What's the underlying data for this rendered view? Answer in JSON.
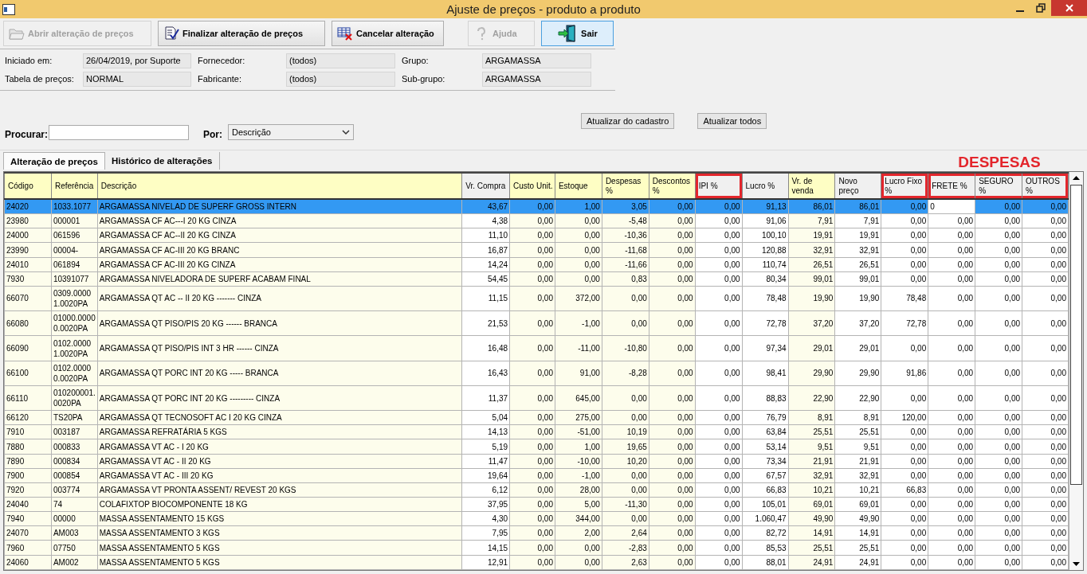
{
  "window": {
    "title": "Ajuste de preços - produto a produto"
  },
  "toolbar": [
    {
      "label": "Abrir alteração de preços",
      "kind": "open",
      "disabled": true,
      "focused": false
    },
    {
      "label": "Finalizar alteração de preços",
      "kind": "finish",
      "disabled": false,
      "focused": false
    },
    {
      "label": "Cancelar alteração",
      "kind": "cancel",
      "disabled": false,
      "focused": false
    },
    {
      "label": "Ajuda",
      "kind": "help",
      "disabled": true,
      "focused": false
    },
    {
      "label": "Sair",
      "kind": "exit",
      "disabled": false,
      "focused": true
    }
  ],
  "info": [
    {
      "label": "Iniciado em:",
      "value": "26/04/2019, por Suporte"
    },
    {
      "label": "Fornecedor:",
      "value": "(todos)"
    },
    {
      "label": "Grupo:",
      "value": "ARGAMASSA"
    },
    {
      "label": "Tabela de preços:",
      "value": "NORMAL"
    },
    {
      "label": "Fabricante:",
      "value": "(todos)"
    },
    {
      "label": "Sub-grupo:",
      "value": "ARGAMASSA"
    }
  ],
  "search": {
    "label": "Procurar:",
    "by_label": "Por:",
    "by_value": "Descrição",
    "buttons": [
      "Atualizar do cadastro",
      "Atualizar todos"
    ]
  },
  "tabs": [
    {
      "label": "Alteração de preços",
      "selected": true
    },
    {
      "label": "Histórico de alterações",
      "selected": false
    }
  ],
  "annotation": {
    "label": "DESPESAS"
  },
  "table": {
    "columns": [
      {
        "label": "Código",
        "numeric": false,
        "editable": true,
        "marked": false,
        "in_annotation": false,
        "current": false
      },
      {
        "label": "Referência",
        "numeric": false,
        "editable": true,
        "marked": false,
        "in_annotation": false,
        "current": false
      },
      {
        "label": "Descrição",
        "numeric": false,
        "editable": true,
        "marked": false,
        "in_annotation": false,
        "current": false
      },
      {
        "label": "Vr. Compra",
        "numeric": true,
        "editable": false,
        "marked": false,
        "in_annotation": false,
        "current": false
      },
      {
        "label": "Custo Unit.",
        "numeric": true,
        "editable": true,
        "marked": false,
        "in_annotation": false,
        "current": false
      },
      {
        "label": "Estoque",
        "numeric": true,
        "editable": true,
        "marked": false,
        "in_annotation": false,
        "current": false
      },
      {
        "label": "Despesas %",
        "numeric": true,
        "editable": true,
        "marked": false,
        "in_annotation": false,
        "current": false
      },
      {
        "label": "Descontos %",
        "numeric": true,
        "editable": true,
        "marked": false,
        "in_annotation": false,
        "current": false
      },
      {
        "label": "IPI %",
        "numeric": true,
        "editable": false,
        "marked": true,
        "in_annotation": false,
        "current": false
      },
      {
        "label": "Lucro %",
        "numeric": true,
        "editable": false,
        "marked": false,
        "in_annotation": false,
        "current": false
      },
      {
        "label": "Vr. de venda",
        "numeric": true,
        "editable": true,
        "marked": false,
        "in_annotation": false,
        "current": false
      },
      {
        "label": "Novo preço",
        "numeric": true,
        "editable": false,
        "marked": false,
        "in_annotation": false,
        "current": false
      },
      {
        "label": "Lucro Fixo %",
        "numeric": true,
        "editable": false,
        "marked": true,
        "in_annotation": false,
        "current": false
      },
      {
        "label": "FRETE %",
        "numeric": true,
        "editable": false,
        "marked": false,
        "in_annotation": true,
        "current": true
      },
      {
        "label": "SEGURO %",
        "numeric": true,
        "editable": false,
        "marked": false,
        "in_annotation": true,
        "current": false
      },
      {
        "label": "OUTROS %",
        "numeric": true,
        "editable": false,
        "marked": false,
        "in_annotation": true,
        "current": false
      }
    ],
    "rows": [
      {
        "selected": true,
        "cells": [
          "24020",
          "1033.1077",
          "ARGAMASSA  NIVELAD DE SUPERF GROSS INTERN",
          "43,67",
          "0,00",
          "1,00",
          "3,05",
          "0,00",
          "0,00",
          "91,13",
          "86,01",
          "86,01",
          "0,00",
          "0",
          "0,00",
          "0,00"
        ]
      },
      {
        "selected": false,
        "cells": [
          "23980",
          "000001",
          "ARGAMASSA CF AC---I 20 KG CINZA",
          "4,38",
          "0,00",
          "0,00",
          "-5,48",
          "0,00",
          "0,00",
          "91,06",
          "7,91",
          "7,91",
          "0,00",
          "0,00",
          "0,00",
          "0,00"
        ]
      },
      {
        "selected": false,
        "cells": [
          "24000",
          "061596",
          "ARGAMASSA CF AC--II  20 KG CINZA",
          "11,10",
          "0,00",
          "0,00",
          "-10,36",
          "0,00",
          "0,00",
          "100,10",
          "19,91",
          "19,91",
          "0,00",
          "0,00",
          "0,00",
          "0,00"
        ]
      },
      {
        "selected": false,
        "cells": [
          "23990",
          "00004-",
          "ARGAMASSA CF AC-III  20 KG BRANC",
          "16,87",
          "0,00",
          "0,00",
          "-11,68",
          "0,00",
          "0,00",
          "120,88",
          "32,91",
          "32,91",
          "0,00",
          "0,00",
          "0,00",
          "0,00"
        ]
      },
      {
        "selected": false,
        "cells": [
          "24010",
          "061894",
          "ARGAMASSA CF AC-III  20 KG CINZA",
          "14,24",
          "0,00",
          "0,00",
          "-11,66",
          "0,00",
          "0,00",
          "110,74",
          "26,51",
          "26,51",
          "0,00",
          "0,00",
          "0,00",
          "0,00"
        ]
      },
      {
        "selected": false,
        "cells": [
          "7930",
          "10391077",
          "ARGAMASSA NIVELADORA DE SUPERF ACABAM FINAL",
          "54,45",
          "0,00",
          "0,00",
          "0,83",
          "0,00",
          "0,00",
          "80,34",
          "99,01",
          "99,01",
          "0,00",
          "0,00",
          "0,00",
          "0,00"
        ]
      },
      {
        "selected": false,
        "cells": [
          "66070",
          "0309.00001.0020PA",
          "ARGAMASSA QT AC -- II 20 KG ------- CINZA",
          "11,15",
          "0,00",
          "372,00",
          "0,00",
          "0,00",
          "0,00",
          "78,48",
          "19,90",
          "19,90",
          "78,48",
          "0,00",
          "0,00",
          "0,00"
        ]
      },
      {
        "selected": false,
        "cells": [
          "66080",
          "01000.00000.0020PA",
          "ARGAMASSA QT PISO/PIS 20 KG ------ BRANCA",
          "21,53",
          "0,00",
          "-1,00",
          "0,00",
          "0,00",
          "0,00",
          "72,78",
          "37,20",
          "37,20",
          "72,78",
          "0,00",
          "0,00",
          "0,00"
        ]
      },
      {
        "selected": false,
        "cells": [
          "66090",
          "0102.00001.0020PA",
          "ARGAMASSA QT PISO/PIS INT 3 HR ------ CINZA",
          "16,48",
          "0,00",
          "-11,00",
          "-10,80",
          "0,00",
          "0,00",
          "97,34",
          "29,01",
          "29,01",
          "0,00",
          "0,00",
          "0,00",
          "0,00"
        ]
      },
      {
        "selected": false,
        "cells": [
          "66100",
          "0102.00000.0020PA",
          "ARGAMASSA QT PORC INT 20 KG ----- BRANCA",
          "16,43",
          "0,00",
          "91,00",
          "-8,28",
          "0,00",
          "0,00",
          "98,41",
          "29,90",
          "29,90",
          "91,86",
          "0,00",
          "0,00",
          "0,00"
        ]
      },
      {
        "selected": false,
        "cells": [
          "66110",
          "010200001.0020PA",
          "ARGAMASSA QT PORC INT 20 KG --------- CINZA",
          "11,37",
          "0,00",
          "645,00",
          "0,00",
          "0,00",
          "0,00",
          "88,83",
          "22,90",
          "22,90",
          "0,00",
          "0,00",
          "0,00",
          "0,00"
        ]
      },
      {
        "selected": false,
        "cells": [
          "66120",
          "TS20PA",
          "ARGAMASSA QT TECNOSOFT AC I 20 KG CINZA",
          "5,04",
          "0,00",
          "275,00",
          "0,00",
          "0,00",
          "0,00",
          "76,79",
          "8,91",
          "8,91",
          "120,00",
          "0,00",
          "0,00",
          "0,00"
        ]
      },
      {
        "selected": false,
        "cells": [
          "7910",
          "003187",
          "ARGAMASSA REFRATÁRIA 5 KGS",
          "14,13",
          "0,00",
          "-51,00",
          "10,19",
          "0,00",
          "0,00",
          "63,84",
          "25,51",
          "25,51",
          "0,00",
          "0,00",
          "0,00",
          "0,00"
        ]
      },
      {
        "selected": false,
        "cells": [
          "7880",
          "000833",
          "ARGAMASSA VT AC - I 20 KG",
          "5,19",
          "0,00",
          "1,00",
          "19,65",
          "0,00",
          "0,00",
          "53,14",
          "9,51",
          "9,51",
          "0,00",
          "0,00",
          "0,00",
          "0,00"
        ]
      },
      {
        "selected": false,
        "cells": [
          "7890",
          "000834",
          "ARGAMASSA VT AC - II 20 KG",
          "11,47",
          "0,00",
          "-10,00",
          "10,20",
          "0,00",
          "0,00",
          "73,34",
          "21,91",
          "21,91",
          "0,00",
          "0,00",
          "0,00",
          "0,00"
        ]
      },
      {
        "selected": false,
        "cells": [
          "7900",
          "000854",
          "ARGAMASSA VT AC - III 20 KG",
          "19,64",
          "0,00",
          "-1,00",
          "0,00",
          "0,00",
          "0,00",
          "67,57",
          "32,91",
          "32,91",
          "0,00",
          "0,00",
          "0,00",
          "0,00"
        ]
      },
      {
        "selected": false,
        "cells": [
          "7920",
          "003774",
          "ARGAMASSA VT PRONTA ASSENT/ REVEST 20 KGS",
          "6,12",
          "0,00",
          "28,00",
          "0,00",
          "0,00",
          "0,00",
          "66,83",
          "10,21",
          "10,21",
          "66,83",
          "0,00",
          "0,00",
          "0,00"
        ]
      },
      {
        "selected": false,
        "cells": [
          "24040",
          "74",
          "COLAFIXTOP BIOCOMPONENTE 18  KG",
          "37,95",
          "0,00",
          "5,00",
          "-11,30",
          "0,00",
          "0,00",
          "105,01",
          "69,01",
          "69,01",
          "0,00",
          "0,00",
          "0,00",
          "0,00"
        ]
      },
      {
        "selected": false,
        "cells": [
          "7940",
          "00000",
          "MASSA ASSENTAMENTO 15 KGS",
          "4,30",
          "0,00",
          "344,00",
          "0,00",
          "0,00",
          "0,00",
          "1.060,47",
          "49,90",
          "49,90",
          "0,00",
          "0,00",
          "0,00",
          "0,00"
        ]
      },
      {
        "selected": false,
        "cells": [
          "24070",
          "AM003",
          "MASSA ASSENTAMENTO 3 KGS",
          "7,95",
          "0,00",
          "2,00",
          "2,64",
          "0,00",
          "0,00",
          "82,72",
          "14,91",
          "14,91",
          "0,00",
          "0,00",
          "0,00",
          "0,00"
        ]
      },
      {
        "selected": false,
        "cells": [
          "7960",
          "07750",
          "MASSA ASSENTAMENTO 5 KGS",
          "14,15",
          "0,00",
          "0,00",
          "-2,83",
          "0,00",
          "0,00",
          "85,53",
          "25,51",
          "25,51",
          "0,00",
          "0,00",
          "0,00",
          "0,00"
        ]
      },
      {
        "selected": false,
        "cells": [
          "24060",
          "AM002",
          "MASSA ASSENTAMENTO 5 KGS",
          "12,91",
          "0,00",
          "0,00",
          "2,63",
          "0,00",
          "0,00",
          "88,01",
          "24,91",
          "24,91",
          "0,00",
          "0,00",
          "0,00",
          "0,00"
        ]
      }
    ]
  }
}
